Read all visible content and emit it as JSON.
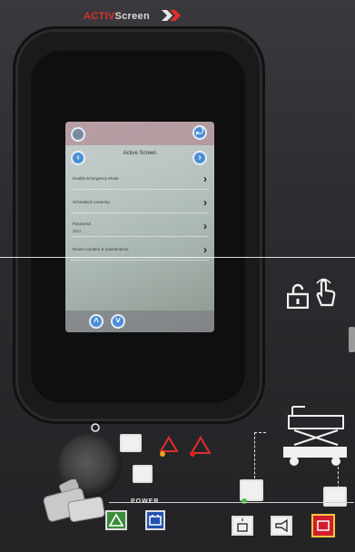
{
  "brand": {
    "activ": "ACTIV",
    "screen": "Screen"
  },
  "display": {
    "title": "Active Screen",
    "rows": [
      {
        "label": "Enable Emergency Mode"
      },
      {
        "label": "Scheduled Lowering"
      },
      {
        "label": "Password",
        "sub": "2111"
      },
      {
        "label": "Reset counters & maintenance"
      }
    ]
  },
  "controls": {
    "power_label": "POWER"
  },
  "colors": {
    "led_amber": "#f0a020",
    "led_red": "#e0201a",
    "led_green": "#3ec03a",
    "accent_red": "#d01f2a"
  }
}
